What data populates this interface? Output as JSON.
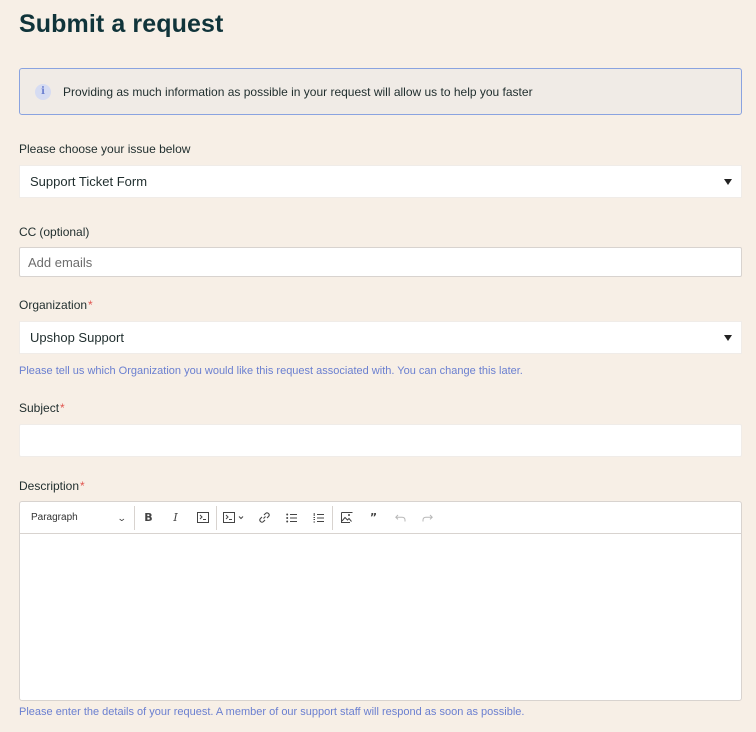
{
  "page": {
    "title": "Submit a request"
  },
  "notice": {
    "icon": "info-icon",
    "text": "Providing as much information as possible in your request will allow us to help you faster"
  },
  "issue": {
    "label": "Please choose your issue below",
    "value": "Support Ticket Form"
  },
  "cc": {
    "label": "CC",
    "optional": "(optional)",
    "placeholder": "Add emails"
  },
  "organization": {
    "label": "Organization",
    "required_mark": "*",
    "value": "Upshop Support",
    "hint": "Please tell us which Organization you would like this request associated with. You can change this later."
  },
  "subject": {
    "label": "Subject",
    "required_mark": "*",
    "value": ""
  },
  "description": {
    "label": "Description",
    "required_mark": "*",
    "paragraph_select": "Paragraph",
    "toolbar_icons": [
      "bold-icon",
      "italic-icon",
      "code-icon",
      "code-block-icon",
      "link-icon",
      "bulleted-list-icon",
      "numbered-list-icon",
      "image-icon",
      "blockquote-icon",
      "undo-icon",
      "redo-icon"
    ],
    "hint": "Please enter the details of your request. A member of our support staff will respond as soon as possible."
  },
  "colors": {
    "title": "#10343a",
    "hint": "#6a7fd0",
    "required": "#e0554f",
    "background": "#f7efe6",
    "notice_border": "#8aa3e0"
  }
}
